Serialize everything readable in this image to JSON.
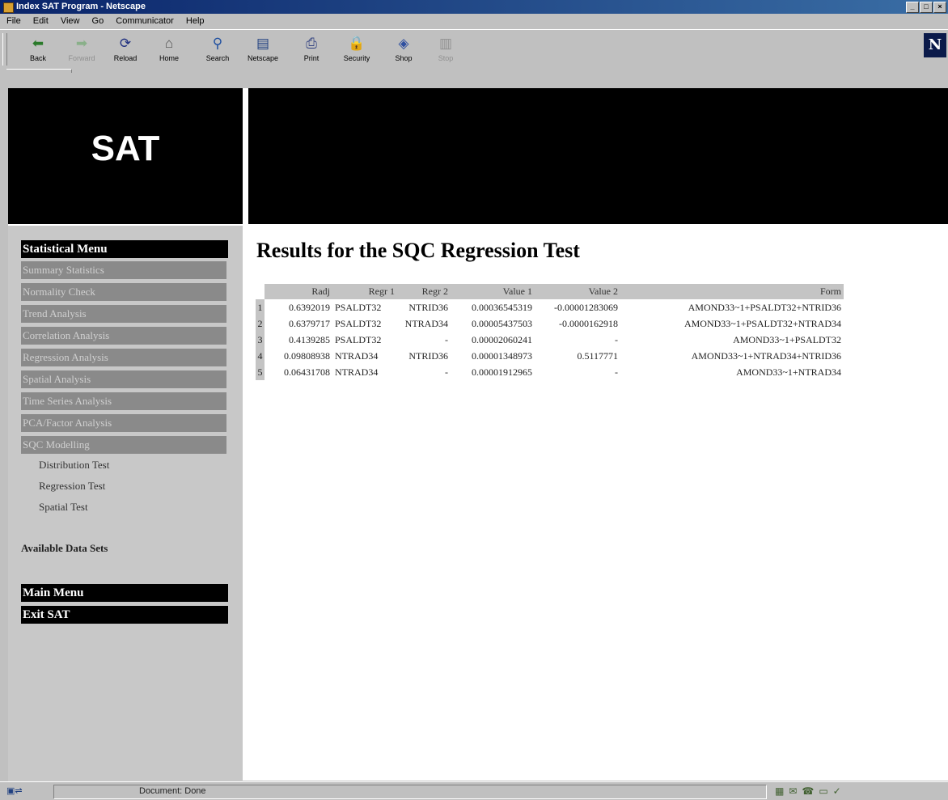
{
  "window": {
    "title": "Index SAT Program - Netscape",
    "controls": [
      "_",
      "□",
      "×"
    ]
  },
  "menubar": [
    "File",
    "Edit",
    "View",
    "Go",
    "Communicator",
    "Help"
  ],
  "toolbar": [
    {
      "label": "Back",
      "icon": "back-arrow-icon",
      "glyph": "⬅"
    },
    {
      "label": "Forward",
      "icon": "forward-arrow-icon",
      "glyph": "➡"
    },
    {
      "label": "Reload",
      "icon": "reload-icon",
      "glyph": "⟳"
    },
    {
      "label": "Home",
      "icon": "home-icon",
      "glyph": "⌂"
    },
    {
      "label": "Search",
      "icon": "search-icon",
      "glyph": "⚲"
    },
    {
      "label": "Netscape",
      "icon": "netscape-icon",
      "glyph": "▤"
    },
    {
      "label": "Print",
      "icon": "print-icon",
      "glyph": "⎙"
    },
    {
      "label": "Security",
      "icon": "security-lock-icon",
      "glyph": "🔒"
    },
    {
      "label": "Shop",
      "icon": "shop-icon",
      "glyph": "◈"
    },
    {
      "label": "Stop",
      "icon": "stop-icon",
      "glyph": "▥"
    }
  ],
  "brand": {
    "logo_text": "N"
  },
  "banner": {
    "title": "SAT"
  },
  "sidebar": {
    "heading": "Statistical Menu",
    "items": [
      "Summary Statistics",
      "Normality Check",
      "Trend Analysis",
      "Correlation Analysis",
      "Regression Analysis",
      "Spatial Analysis",
      "Time Series Analysis",
      "PCA/Factor Analysis",
      "SQC Modelling"
    ],
    "subitems": [
      "Distribution Test",
      "Regression Test",
      "Spatial Test"
    ],
    "available": "Available Data Sets",
    "main_menu": "Main Menu",
    "exit": "Exit SAT"
  },
  "results": {
    "title": "Results for the SQC Regression Test",
    "columns": [
      "Radj",
      "Regr 1",
      "Regr 2",
      "Value 1",
      "Value 2",
      "Form"
    ],
    "rows": [
      [
        "1",
        "0.6392019",
        "PSALDT32",
        "NTRID36",
        "0.00036545319",
        "-0.00001283069",
        "AMOND33~1+PSALDT32+NTRID36"
      ],
      [
        "2",
        "0.6379717",
        "PSALDT32",
        "NTRAD34",
        "0.00005437503",
        "-0.0000162918",
        "AMOND33~1+PSALDT32+NTRAD34"
      ],
      [
        "3",
        "0.4139285",
        "PSALDT32",
        "-",
        "0.00002060241",
        "-",
        "AMOND33~1+PSALDT32"
      ],
      [
        "4",
        "0.09808938",
        "NTRAD34",
        "NTRID36",
        "0.00001348973",
        "0.5117771",
        "AMOND33~1+NTRAD34+NTRID36"
      ],
      [
        "5",
        "0.06431708",
        "NTRAD34",
        "-",
        "0.00001912965",
        "-",
        "AMOND33~1+NTRAD34"
      ]
    ]
  },
  "statusbar": {
    "text": "Document: Done"
  },
  "colors": {
    "titlebar": "#0a246a",
    "sidebar": "#c8c8c8",
    "menu_item": "#8a8a8a",
    "banner": "#000000"
  }
}
